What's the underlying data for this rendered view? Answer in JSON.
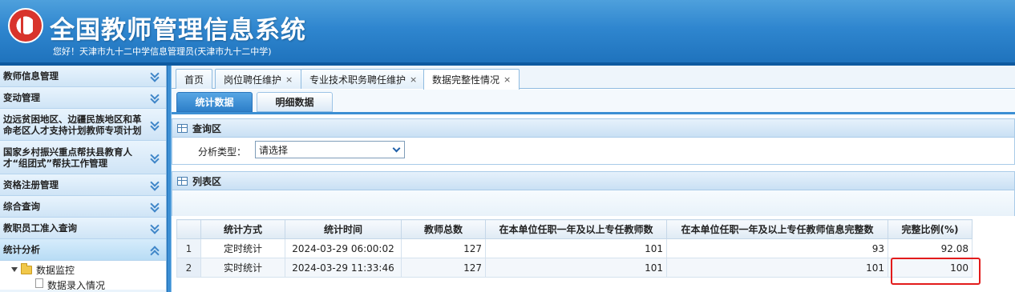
{
  "header": {
    "title": "全国教师管理信息系统",
    "welcome": "您好！天津市九十二中学信息管理员(天津市九十二中学)"
  },
  "sidebar": {
    "items": [
      {
        "label": "教师信息管理"
      },
      {
        "label": "变动管理"
      },
      {
        "label": "边远贫困地区、边疆民族地区和革命老区人才支持计划教师专项计划"
      },
      {
        "label": "国家乡村振兴重点帮扶县教育人才“组团式”帮扶工作管理"
      },
      {
        "label": "资格注册管理"
      },
      {
        "label": "综合查询"
      },
      {
        "label": "教职员工准入查询"
      },
      {
        "label": "统计分析"
      }
    ],
    "tree": {
      "folder": "数据监控",
      "child": "数据录入情况"
    }
  },
  "tabs": [
    {
      "label": "首页"
    },
    {
      "label": "岗位聘任维护"
    },
    {
      "label": "专业技术职务聘任维护"
    },
    {
      "label": "数据完整性情况"
    }
  ],
  "tab_close_glyph": "×",
  "subtabs": [
    {
      "label": "统计数据"
    },
    {
      "label": "明细数据"
    }
  ],
  "query": {
    "title": "查询区",
    "label": "分析类型：",
    "select_value": "请选择"
  },
  "list": {
    "title": "列表区",
    "columns": [
      "",
      "统计方式",
      "统计时间",
      "教师总数",
      "在本单位任职一年及以上专任教师数",
      "在本单位任职一年及以上专任教师信息完整数",
      "完整比例(%)"
    ],
    "rows": [
      [
        "1",
        "定时统计",
        "2024-03-29 06:00:02",
        "127",
        "101",
        "93",
        "92.08"
      ],
      [
        "2",
        "实时统计",
        "2024-03-29 11:33:46",
        "127",
        "101",
        "101",
        "100"
      ]
    ]
  },
  "colors": {
    "header_blue": "#2f86cf",
    "accent_blue": "#3c8fd4",
    "highlight_red": "#e21b1b"
  }
}
